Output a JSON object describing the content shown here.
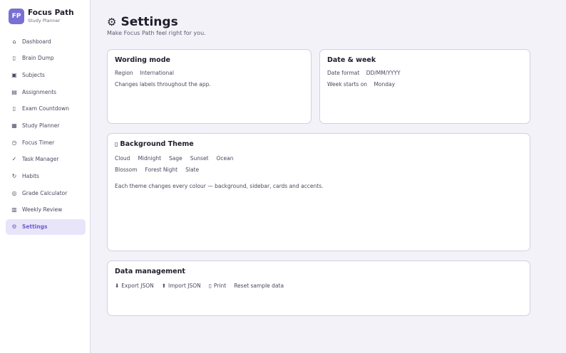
{
  "brand": {
    "logo": "FP",
    "name": "Focus Path",
    "subtitle": "Study Planner"
  },
  "nav": [
    {
      "icon": "⌂",
      "icon_name": "home-icon",
      "label": "Dashboard"
    },
    {
      "icon": "▯",
      "icon_name": "brain-icon",
      "label": "Brain Dump"
    },
    {
      "icon": "▣",
      "icon_name": "book-icon",
      "label": "Subjects"
    },
    {
      "icon": "▤",
      "icon_name": "assignment-icon",
      "label": "Assignments"
    },
    {
      "icon": "▯",
      "icon_name": "countdown-icon",
      "label": "Exam Countdown"
    },
    {
      "icon": "▦",
      "icon_name": "calendar-icon",
      "label": "Study Planner"
    },
    {
      "icon": "◷",
      "icon_name": "clock-icon",
      "label": "Focus Timer"
    },
    {
      "icon": "✓",
      "icon_name": "check-icon",
      "label": "Task Manager"
    },
    {
      "icon": "↻",
      "icon_name": "refresh-icon",
      "label": "Habits"
    },
    {
      "icon": "◎",
      "icon_name": "target-icon",
      "label": "Grade Calculator"
    },
    {
      "icon": "▥",
      "icon_name": "review-icon",
      "label": "Weekly Review"
    },
    {
      "icon": "⚙",
      "icon_name": "gear-icon",
      "label": "Settings"
    }
  ],
  "active_nav": "Settings",
  "page": {
    "icon": "⚙",
    "title": "Settings",
    "subtitle": "Make Focus Path feel right for you."
  },
  "wording": {
    "title": "Wording mode",
    "region_label": "Region",
    "region_value": "International",
    "note": "Changes labels throughout the app."
  },
  "date_week": {
    "title": "Date & week",
    "format_label": "Date format",
    "format_value": "DD/MM/YYYY",
    "week_label": "Week starts on",
    "week_value": "Monday"
  },
  "theme": {
    "icon": "▯",
    "title": "Background Theme",
    "options_row1": [
      "Cloud",
      "Midnight",
      "Sage",
      "Sunset",
      "Ocean"
    ],
    "options_row2": [
      "Blossom",
      "Forest Night",
      "Slate"
    ],
    "note": "Each theme changes every colour — background, sidebar, cards and accents."
  },
  "data_mgmt": {
    "title": "Data management",
    "export_icon": "⬇",
    "export_label": "Export JSON",
    "import_icon": "⬆",
    "import_label": "Import JSON",
    "print_icon": "▯",
    "print_label": "Print",
    "reset_label": "Reset sample data"
  },
  "colors": {
    "accent": "#7a6fd4",
    "active_bg": "#e8e5fa",
    "page_bg": "#f4f2f9",
    "card_border": "#d3cfe3"
  }
}
